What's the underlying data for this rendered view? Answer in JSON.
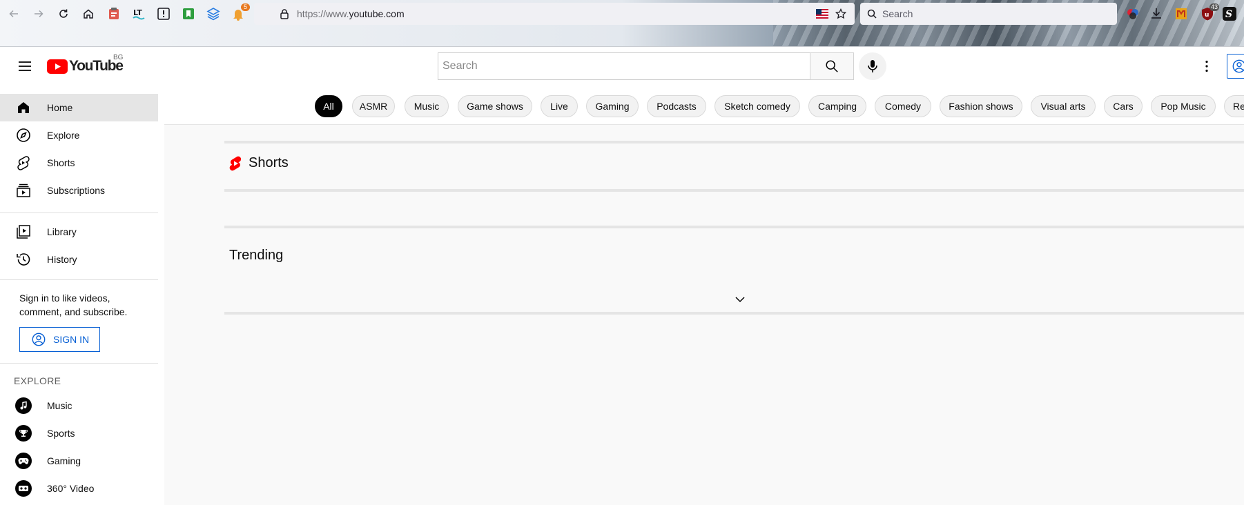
{
  "browser": {
    "url_prefix": "https://www.",
    "url_domain": "youtube.com",
    "search_placeholder": "Search",
    "extension_badges": {
      "notifications": "5",
      "ublock": "43"
    },
    "extension_letter": "S"
  },
  "header": {
    "logo_text": "YouTube",
    "country_code": "BG",
    "search_placeholder": "Search"
  },
  "sidebar": {
    "primary": [
      {
        "label": "Home",
        "icon": "home-icon",
        "active": true
      },
      {
        "label": "Explore",
        "icon": "compass-icon"
      },
      {
        "label": "Shorts",
        "icon": "shorts-icon"
      },
      {
        "label": "Subscriptions",
        "icon": "subscriptions-icon"
      }
    ],
    "secondary": [
      {
        "label": "Library",
        "icon": "library-icon"
      },
      {
        "label": "History",
        "icon": "history-icon"
      }
    ],
    "signin_promo": "Sign in to like videos, comment, and subscribe.",
    "signin_label": "SIGN IN",
    "explore_heading": "EXPLORE",
    "explore": [
      {
        "label": "Music",
        "icon": "music-note-icon"
      },
      {
        "label": "Sports",
        "icon": "trophy-icon"
      },
      {
        "label": "Gaming",
        "icon": "gamepad-icon"
      },
      {
        "label": "360° Video",
        "icon": "vr-headset-icon"
      }
    ]
  },
  "chips": [
    "All",
    "ASMR",
    "Music",
    "Game shows",
    "Live",
    "Gaming",
    "Podcasts",
    "Sketch comedy",
    "Camping",
    "Comedy",
    "Fashion shows",
    "Visual arts",
    "Cars",
    "Pop Music",
    "Re"
  ],
  "selected_chip": "All",
  "main": {
    "shorts_title": "Shorts",
    "trending_title": "Trending"
  },
  "colors": {
    "brand_red": "#ff0000",
    "link_blue": "#065fd4",
    "chip_selected": "#030303"
  }
}
